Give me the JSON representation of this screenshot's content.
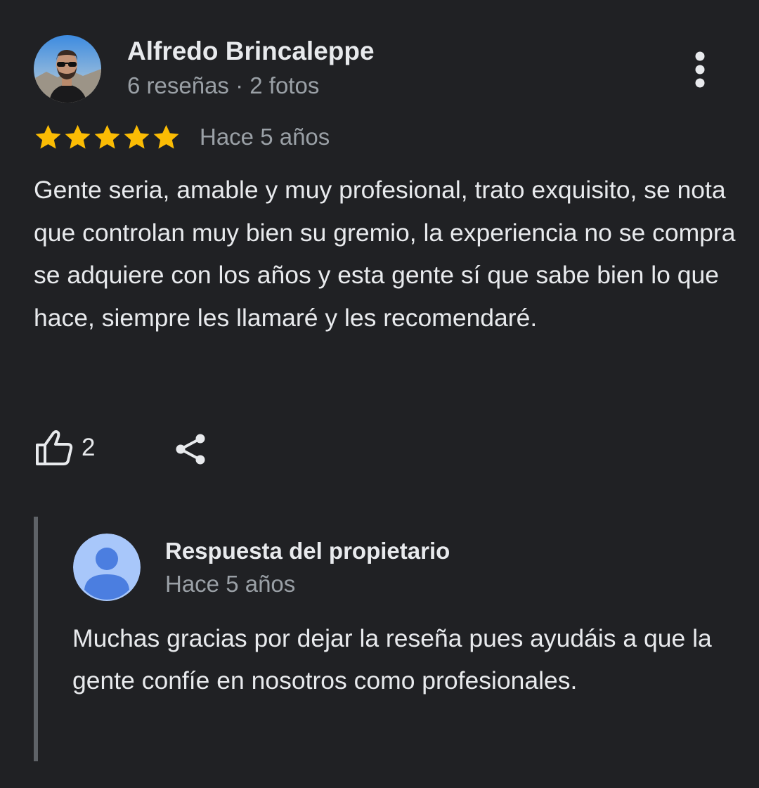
{
  "review": {
    "author_name": "Alfredo Brincaleppe",
    "author_meta": "6 reseñas · 2 fotos",
    "rating": 5,
    "rating_max": 5,
    "date": "Hace 5 años",
    "text": "Gente seria, amable y muy profesional, trato exquisito, se nota que controlan muy bien su gremio, la experiencia no se compra se adquiere con los años y esta gente sí que sabe bien lo que hace, siempre les llamaré y les recomendaré.",
    "like_count": "2",
    "icons": {
      "more": "more-vert-icon",
      "like": "thumbs-up-icon",
      "share": "share-icon",
      "star": "star-icon"
    }
  },
  "owner_response": {
    "title": "Respuesta del propietario",
    "date": "Hace 5 años",
    "text": "Muchas gracias por dejar la reseña pues ayudáis a que la gente confíe en nosotros como profesionales."
  },
  "colors": {
    "background": "#202124",
    "primary_text": "#e8eaed",
    "secondary_text": "#9aa0a6",
    "star": "#fbbc04",
    "reply_border": "#5f6368",
    "owner_avatar_bg": "#a8c7fa",
    "owner_avatar_figure": "#4b7ee0"
  }
}
